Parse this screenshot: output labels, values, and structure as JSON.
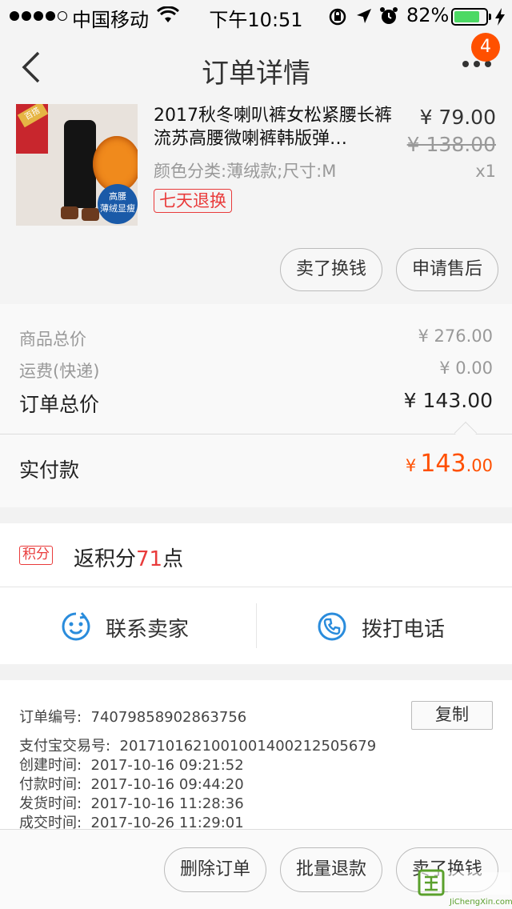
{
  "status_bar": {
    "carrier": "中国移动",
    "time": "下午10:51",
    "battery_text": "82%",
    "battery_level": 0.82
  },
  "nav": {
    "title": "订单详情",
    "badge_count": "4"
  },
  "product": {
    "name": "2017秋冬喇叭裤女松紧腰长裤流苏高腰微喇裤韩版弹…",
    "attributes": "颜色分类:薄绒款;尺寸:M",
    "return_badge": "七天退换",
    "price": "¥ 79.00",
    "original_price": "¥ 138.00",
    "quantity": "x1",
    "thumb_text": {
      "tag": "百搭",
      "circle_line1": "高腰",
      "circle_line2": "薄绒显瘦"
    },
    "buttons": {
      "sell": "卖了换钱",
      "after_sale": "申请售后"
    }
  },
  "summary": {
    "goods_total_label": "商品总价",
    "goods_total": "¥ 276.00",
    "shipping_label": "运费(快递)",
    "shipping": "¥ 0.00",
    "order_total_label": "订单总价",
    "order_total": "¥ 143.00",
    "paid_label": "实付款",
    "paid_currency": "¥",
    "paid_integer": "143",
    "paid_decimal": ".00"
  },
  "points": {
    "chip": "积分",
    "prefix": "返积分",
    "amount": "71",
    "suffix": "点"
  },
  "contact": {
    "seller": "联系卖家",
    "phone": "拨打电话"
  },
  "order_info": {
    "copy_label": "复制",
    "rows": [
      {
        "key": "订单编号:",
        "value": "74079858902863756"
      },
      {
        "key": "支付宝交易号:",
        "value": "2017101621001001400212505679"
      },
      {
        "key": "创建时间:",
        "value": "2017-10-16 09:21:52"
      },
      {
        "key": "付款时间:",
        "value": "2017-10-16 09:44:20"
      },
      {
        "key": "发货时间:",
        "value": "2017-10-16 11:28:36"
      },
      {
        "key": "成交时间:",
        "value": "2017-10-26 11:29:01"
      }
    ]
  },
  "bottom_bar": {
    "delete": "删除订单",
    "batch_refund": "批量退款",
    "sell": "卖了换钱"
  },
  "watermark": {
    "text": "ЈіСһепgXіп.соm"
  },
  "colors": {
    "accent_orange": "#ff5000",
    "accent_red": "#e93b3b",
    "contact_blue": "#2a8cdc"
  }
}
